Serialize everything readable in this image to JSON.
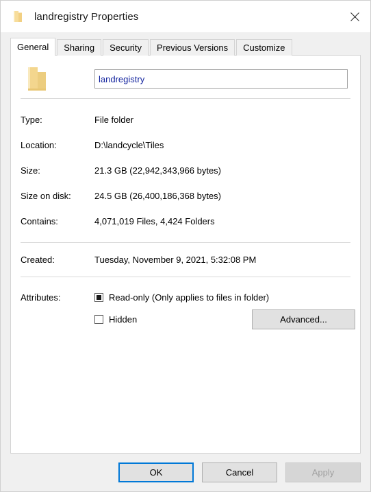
{
  "window": {
    "title": "landregistry Properties",
    "icon": "folder-icon",
    "close_label": "✕"
  },
  "tabs": [
    {
      "label": "General",
      "active": true
    },
    {
      "label": "Sharing",
      "active": false
    },
    {
      "label": "Security",
      "active": false
    },
    {
      "label": "Previous Versions",
      "active": false
    },
    {
      "label": "Customize",
      "active": false
    }
  ],
  "general": {
    "folder_icon": "folder-icon",
    "name_value": "landregistry",
    "name_placeholder": "",
    "properties": [
      {
        "label": "Type:",
        "value": "File folder"
      },
      {
        "label": "Location:",
        "value": "D:\\landcycle\\Tiles"
      },
      {
        "label": "Size:",
        "value": "21.3 GB (22,942,343,966 bytes)"
      },
      {
        "label": "Size on disk:",
        "value": "24.5 GB (26,400,186,368 bytes)"
      },
      {
        "label": "Contains:",
        "value": "4,071,019 Files, 4,424 Folders"
      }
    ],
    "created": {
      "label": "Created:",
      "value": "Tuesday, November 9, 2021, 5:32:08 PM"
    },
    "attributes": {
      "label": "Attributes:",
      "readonly_label": "Read-only (Only applies to files in folder)",
      "readonly_state": "indeterminate",
      "hidden_label": "Hidden",
      "hidden_state": "unchecked",
      "advanced_label": "Advanced..."
    }
  },
  "footer": {
    "ok_label": "OK",
    "cancel_label": "Cancel",
    "apply_label": "Apply",
    "apply_disabled": true
  },
  "colors": {
    "accent": "#0078d7",
    "folder": "#f5d98a",
    "panel": "#ffffff",
    "dialog": "#f0f0f0",
    "input_text": "#12239e"
  }
}
